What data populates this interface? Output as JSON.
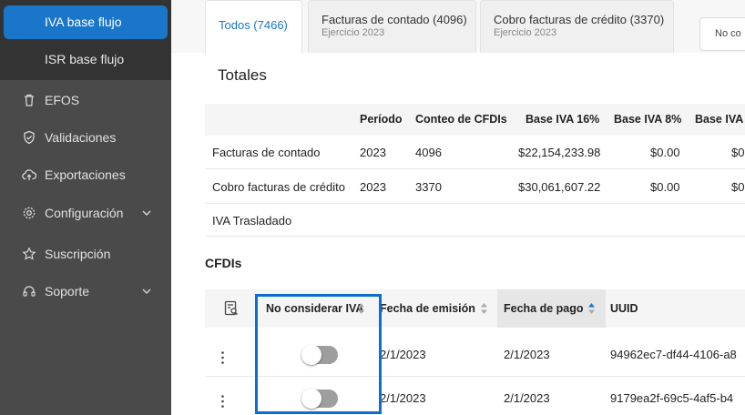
{
  "sidebar": {
    "active_item": "IVA base flujo",
    "sub_item": "ISR base flujo",
    "items": [
      {
        "label": "EFOS",
        "icon": "trash-icon"
      },
      {
        "label": "Validaciones",
        "icon": "shield-check-icon"
      },
      {
        "label": "Exportaciones",
        "icon": "cloud-upload-icon"
      },
      {
        "label": "Configuración",
        "icon": "gear-icon"
      },
      {
        "label": "Suscripción",
        "icon": "star-icon"
      },
      {
        "label": "Soporte",
        "icon": "support-icon"
      }
    ]
  },
  "tabs": [
    {
      "label": "Todos (7466)",
      "sub": ""
    },
    {
      "label": "Facturas de contado (4096)",
      "sub": "Ejercicio 2023"
    },
    {
      "label": "Cobro facturas de crédito (3370)",
      "sub": "Ejercicio 2023"
    }
  ],
  "tab_right_text": "No co",
  "totales": {
    "title": "Totales",
    "headers": [
      "Período",
      "Conteo de CFDIs",
      "Base IVA 16%",
      "Base IVA 8%",
      "Base IVA"
    ],
    "rows": [
      {
        "concepto": "Facturas de contado",
        "periodo": "2023",
        "conteo": "4096",
        "base16": "$22,154,233.98",
        "base8": "$0.00",
        "base_x": "$0"
      },
      {
        "concepto": "Cobro facturas de crédito",
        "periodo": "2023",
        "conteo": "3370",
        "base16": "$30,061,607.22",
        "base8": "$0.00",
        "base_x": "$0"
      }
    ],
    "iva_trasladado": "IVA Trasladado"
  },
  "cfdis": {
    "title": "CFDIs",
    "headers": {
      "no_iva": "No considerar IVA",
      "fecha_emision": "Fecha de emisión",
      "fecha_pago": "Fecha de pago",
      "uuid": "UUID"
    },
    "rows": [
      {
        "no_iva": false,
        "fecha_emision": "2/1/2023",
        "fecha_pago": "2/1/2023",
        "uuid": "94962ec7-df44-4106-a8"
      },
      {
        "no_iva": false,
        "fecha_emision": "2/1/2023",
        "fecha_pago": "2/1/2023",
        "uuid": "9179ea2f-69c5-4af5-b4"
      }
    ]
  },
  "colors": {
    "accent": "#1976c8",
    "highlight": "#0a6fd0"
  }
}
